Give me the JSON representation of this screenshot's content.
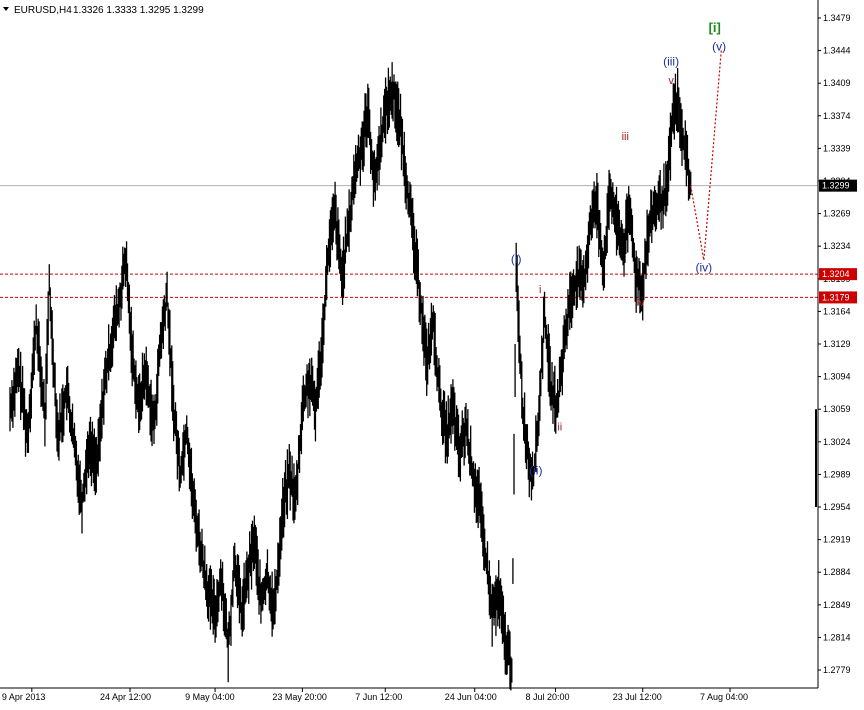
{
  "header": {
    "menu_icon": "triangle-down-icon",
    "symbol": "EURUSD,H4",
    "ohlc": "1.3326 1.3333 1.3295 1.3299"
  },
  "chart_data": {
    "type": "candlestick",
    "symbol": "EURUSD",
    "timeframe": "H4",
    "ylim": [
      1.2764,
      1.3494
    ],
    "y_ticks": [
      "1.3479",
      "1.3444",
      "1.3409",
      "1.3374",
      "1.3339",
      "1.3304",
      "1.3269",
      "1.3234",
      "1.3199",
      "1.3164",
      "1.3129",
      "1.3094",
      "1.3059",
      "1.3024",
      "1.2989",
      "1.2954",
      "1.2919",
      "1.2884",
      "1.2849",
      "1.2814",
      "1.2779"
    ],
    "x_ticks": [
      "9 Apr 2013",
      "24 Apr 12:00",
      "9 May 04:00",
      "23 May 20:00",
      "7 Jun 12:00",
      "24 Jun 04:00",
      "8 Jul 20:00",
      "23 Jul 12:00",
      "7 Aug 04:00"
    ],
    "x_range_bars": [
      0,
      330
    ],
    "x_tick_bars": [
      10,
      55,
      94,
      134,
      172,
      213,
      250,
      290,
      330
    ],
    "current_price": {
      "value": 1.3299,
      "label": "1.3299"
    },
    "levels": [
      {
        "value": 1.3204,
        "label": "1.3204",
        "color": "#cc0000"
      },
      {
        "value": 1.3179,
        "label": "1.3179",
        "color": "#cc0000"
      }
    ],
    "price_path": [
      [
        0,
        1.306
      ],
      [
        4,
        1.31
      ],
      [
        8,
        1.303
      ],
      [
        12,
        1.315
      ],
      [
        16,
        1.305
      ],
      [
        18,
        1.319
      ],
      [
        22,
        1.303
      ],
      [
        26,
        1.308
      ],
      [
        30,
        1.301
      ],
      [
        33,
        1.296
      ],
      [
        36,
        1.302
      ],
      [
        40,
        1.3
      ],
      [
        43,
        1.308
      ],
      [
        47,
        1.314
      ],
      [
        50,
        1.317
      ],
      [
        53,
        1.322
      ],
      [
        56,
        1.312
      ],
      [
        59,
        1.306
      ],
      [
        62,
        1.31
      ],
      [
        66,
        1.304
      ],
      [
        69,
        1.313
      ],
      [
        72,
        1.318
      ],
      [
        75,
        1.306
      ],
      [
        78,
        1.299
      ],
      [
        81,
        1.304
      ],
      [
        84,
        1.296
      ],
      [
        88,
        1.29
      ],
      [
        91,
        1.286
      ],
      [
        94,
        1.284
      ],
      [
        97,
        1.288
      ],
      [
        100,
        1.28
      ],
      [
        103,
        1.29
      ],
      [
        106,
        1.284
      ],
      [
        109,
        1.288
      ],
      [
        112,
        1.292
      ],
      [
        115,
        1.285
      ],
      [
        118,
        1.288
      ],
      [
        121,
        1.284
      ],
      [
        125,
        1.295
      ],
      [
        128,
        1.299
      ],
      [
        131,
        1.296
      ],
      [
        134,
        1.306
      ],
      [
        137,
        1.309
      ],
      [
        140,
        1.306
      ],
      [
        143,
        1.313
      ],
      [
        146,
        1.323
      ],
      [
        149,
        1.327
      ],
      [
        152,
        1.32
      ],
      [
        155,
        1.325
      ],
      [
        158,
        1.331
      ],
      [
        161,
        1.334
      ],
      [
        164,
        1.338
      ],
      [
        167,
        1.33
      ],
      [
        170,
        1.335
      ],
      [
        173,
        1.339
      ],
      [
        176,
        1.34
      ],
      [
        179,
        1.336
      ],
      [
        182,
        1.33
      ],
      [
        185,
        1.324
      ],
      [
        188,
        1.318
      ],
      [
        191,
        1.311
      ],
      [
        194,
        1.315
      ],
      [
        197,
        1.307
      ],
      [
        200,
        1.303
      ],
      [
        203,
        1.306
      ],
      [
        206,
        1.301
      ],
      [
        209,
        1.304
      ],
      [
        212,
        1.299
      ],
      [
        215,
        1.296
      ],
      [
        218,
        1.29
      ],
      [
        221,
        1.284
      ],
      [
        224,
        1.286
      ],
      [
        227,
        1.281
      ],
      [
        230,
        1.278
      ],
      [
        232,
        1.321
      ],
      [
        235,
        1.306
      ],
      [
        238,
        1.3
      ],
      [
        240,
        1.299
      ],
      [
        242,
        1.304
      ],
      [
        245,
        1.316
      ],
      [
        248,
        1.308
      ],
      [
        251,
        1.306
      ],
      [
        254,
        1.313
      ],
      [
        257,
        1.318
      ],
      [
        260,
        1.32
      ],
      [
        263,
        1.319
      ],
      [
        266,
        1.326
      ],
      [
        269,
        1.328
      ],
      [
        272,
        1.321
      ],
      [
        275,
        1.329
      ],
      [
        278,
        1.326
      ],
      [
        281,
        1.323
      ],
      [
        284,
        1.327
      ],
      [
        287,
        1.32
      ],
      [
        290,
        1.319
      ],
      [
        292,
        1.324
      ],
      [
        295,
        1.327
      ],
      [
        298,
        1.328
      ],
      [
        301,
        1.329
      ],
      [
        304,
        1.338
      ],
      [
        306,
        1.339
      ],
      [
        308,
        1.335
      ],
      [
        310,
        1.333
      ],
      [
        312,
        1.3299
      ]
    ],
    "projection": [
      [
        312,
        1.3299
      ],
      [
        318,
        1.3219
      ],
      [
        326,
        1.3444
      ]
    ],
    "wave_labels": [
      {
        "text": "[i]",
        "bar": 323,
        "price": 1.3464,
        "style": "green"
      },
      {
        "text": "(v)",
        "bar": 325,
        "price": 1.3444,
        "style": "blue"
      },
      {
        "text": "(iii)",
        "bar": 303,
        "price": 1.3428,
        "style": "blue"
      },
      {
        "text": "v",
        "bar": 303,
        "price": 1.3408,
        "style": "red"
      },
      {
        "text": "iii",
        "bar": 282,
        "price": 1.3348,
        "style": "red"
      },
      {
        "text": "(iv)",
        "bar": 318,
        "price": 1.3207,
        "style": "blue"
      },
      {
        "text": "(i)",
        "bar": 232,
        "price": 1.3216,
        "style": "blue"
      },
      {
        "text": "i",
        "bar": 243,
        "price": 1.3184,
        "style": "red"
      },
      {
        "text": "iv",
        "bar": 289,
        "price": 1.317,
        "style": "red"
      },
      {
        "text": "ii",
        "bar": 252,
        "price": 1.3036,
        "style": "red"
      },
      {
        "text": "(ii)",
        "bar": 241,
        "price": 1.2989,
        "style": "blue"
      }
    ]
  }
}
